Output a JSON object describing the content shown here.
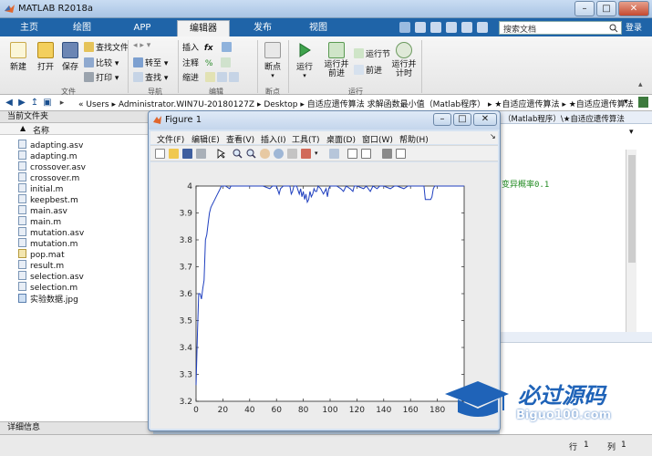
{
  "window": {
    "title": "MATLAB R2018a"
  },
  "tabs": [
    {
      "label": "主页"
    },
    {
      "label": "绘图"
    },
    {
      "label": "APP"
    },
    {
      "label": "编辑器"
    },
    {
      "label": "发布"
    },
    {
      "label": "视图"
    }
  ],
  "search": {
    "placeholder": "搜索文档"
  },
  "login": "登录",
  "ribbon": {
    "file": {
      "new": "新建",
      "open": "打开",
      "save": "保存",
      "find_files": "查找文件",
      "compare": "比较",
      "print": "打印",
      "group": "文件"
    },
    "navigate": {
      "goto": "转至",
      "find": "查找",
      "group": "导航"
    },
    "edit": {
      "insert": "插入",
      "comment": "注释",
      "indent": "缩进",
      "group": "编辑"
    },
    "breakpoints": {
      "label": "断点",
      "group": "断点"
    },
    "run": {
      "run": "运行",
      "run_advance": "运行并前进",
      "run_section": "运行节",
      "advance": "前进",
      "run_time": "运行并计时",
      "group": "运行"
    }
  },
  "address": {
    "path": [
      "Users",
      "Administrator.WIN7U-20180127Z",
      "Desktop",
      "自适应遗传算法 求解函数最小值（Matlab程序）",
      "★自适应遗传算法",
      "★自适应遗传算法"
    ]
  },
  "current_folder": {
    "title": "当前文件夹",
    "column": "名称",
    "files": [
      "adapting.asv",
      "adapting.m",
      "crossover.asv",
      "crossover.m",
      "initial.m",
      "keepbest.m",
      "main.asv",
      "main.m",
      "mutation.asv",
      "mutation.m",
      "pop.mat",
      "result.m",
      "selection.asv",
      "selection.m",
      "实验数据.jpg"
    ],
    "details": "详细信息"
  },
  "editor": {
    "tab_text": "（Matlab程序）\\★自适应遗传算法",
    "code_text": "变异概率0.1"
  },
  "statusbar": {
    "line_label": "行",
    "line_value": "1",
    "col_label": "列",
    "col_value": "1"
  },
  "figure": {
    "title": "Figure 1",
    "menu": [
      "文件(F)",
      "编辑(E)",
      "查看(V)",
      "插入(I)",
      "工具(T)",
      "桌面(D)",
      "窗口(W)",
      "帮助(H)"
    ]
  },
  "watermark": {
    "text": "必过源码",
    "url": "Biguo100.com"
  },
  "colors": {
    "tab_bar": "#1f64a8",
    "plot_line": "#1f3fbf",
    "watermark_blue": "#1f63b8"
  },
  "chart_data": {
    "type": "line",
    "title": "",
    "xlabel": "",
    "ylabel": "",
    "xlim": [
      0,
      200
    ],
    "ylim": [
      3.2,
      4.0
    ],
    "xticks": [
      0,
      20,
      40,
      60,
      80,
      100,
      120,
      140,
      160,
      180
    ],
    "yticks": [
      3.2,
      3.3,
      3.4,
      3.5,
      3.6,
      3.7,
      3.8,
      3.9,
      4
    ],
    "grid": false,
    "series": [
      {
        "name": "",
        "points": [
          [
            0,
            3.26
          ],
          [
            1,
            3.45
          ],
          [
            2,
            3.6
          ],
          [
            3,
            3.6
          ],
          [
            4,
            3.58
          ],
          [
            5,
            3.62
          ],
          [
            6,
            3.65
          ],
          [
            7,
            3.8
          ],
          [
            8,
            3.82
          ],
          [
            9,
            3.86
          ],
          [
            10,
            3.9
          ],
          [
            11,
            3.92
          ],
          [
            12,
            3.93
          ],
          [
            13,
            3.94
          ],
          [
            14,
            3.95
          ],
          [
            15,
            3.96
          ],
          [
            16,
            3.97
          ],
          [
            17,
            3.98
          ],
          [
            18,
            3.99
          ],
          [
            19,
            4.0
          ],
          [
            22,
            4.0
          ],
          [
            25,
            3.99
          ],
          [
            26,
            4.0
          ],
          [
            30,
            4.0
          ],
          [
            40,
            4.0
          ],
          [
            50,
            4.0
          ],
          [
            55,
            3.99
          ],
          [
            57,
            4.0
          ],
          [
            60,
            4.0
          ],
          [
            62,
            3.97
          ],
          [
            63,
            3.99
          ],
          [
            65,
            4.0
          ],
          [
            70,
            4.0
          ],
          [
            71,
            3.97
          ],
          [
            72,
            3.98
          ],
          [
            73,
            4.0
          ],
          [
            75,
            4.0
          ],
          [
            77,
            3.97
          ],
          [
            78,
            3.99
          ],
          [
            79,
            3.96
          ],
          [
            80,
            3.98
          ],
          [
            81,
            3.95
          ],
          [
            82,
            3.97
          ],
          [
            83,
            3.94
          ],
          [
            84,
            3.95
          ],
          [
            85,
            3.98
          ],
          [
            86,
            3.96
          ],
          [
            87,
            3.97
          ],
          [
            88,
            3.99
          ],
          [
            89,
            3.98
          ],
          [
            90,
            3.98
          ],
          [
            91,
            4.0
          ],
          [
            93,
            3.99
          ],
          [
            95,
            3.97
          ],
          [
            96,
            3.98
          ],
          [
            97,
            3.99
          ],
          [
            98,
            3.96
          ],
          [
            99,
            3.99
          ],
          [
            100,
            4.0
          ],
          [
            105,
            4.0
          ],
          [
            108,
            3.99
          ],
          [
            110,
            3.98
          ],
          [
            112,
            4.0
          ],
          [
            115,
            3.99
          ],
          [
            117,
            3.98
          ],
          [
            118,
            4.0
          ],
          [
            120,
            4.0
          ],
          [
            125,
            3.99
          ],
          [
            127,
            4.0
          ],
          [
            130,
            3.98
          ],
          [
            132,
            4.0
          ],
          [
            135,
            3.99
          ],
          [
            137,
            4.0
          ],
          [
            140,
            4.0
          ],
          [
            145,
            3.99
          ],
          [
            148,
            4.0
          ],
          [
            150,
            4.0
          ],
          [
            155,
            3.99
          ],
          [
            158,
            4.0
          ],
          [
            160,
            4.0
          ],
          [
            170,
            4.0
          ],
          [
            171,
            3.95
          ],
          [
            172,
            3.95
          ],
          [
            175,
            3.95
          ],
          [
            176,
            3.96
          ],
          [
            177,
            3.99
          ],
          [
            178,
            4.0
          ],
          [
            190,
            4.0
          ],
          [
            200,
            4.0
          ]
        ]
      }
    ]
  }
}
